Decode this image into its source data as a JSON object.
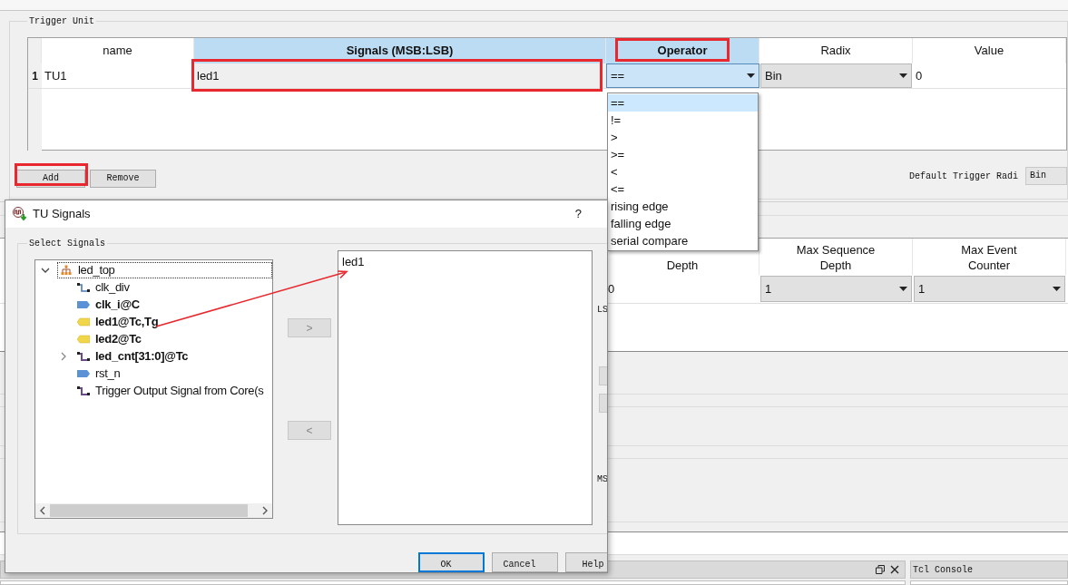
{
  "main": {
    "trigger_unit": {
      "title": "Trigger Unit",
      "columns": [
        {
          "label": "name",
          "selected": false,
          "annotated": false
        },
        {
          "label": "Signals (MSB:LSB)",
          "selected": true,
          "annotated": false
        },
        {
          "label": "Operator",
          "selected": true,
          "annotated": true
        },
        {
          "label": "Radix",
          "selected": false,
          "annotated": false
        },
        {
          "label": "Value",
          "selected": false,
          "annotated": false
        }
      ],
      "rows": [
        {
          "number": "1",
          "name": "TU1",
          "signals": "led1",
          "signals_annotated": true,
          "operator": "==",
          "radix": "Bin",
          "value": "0"
        }
      ],
      "buttons": [
        {
          "label": "Add",
          "annotated": true
        },
        {
          "label": "Remove",
          "annotated": false
        }
      ]
    },
    "default_radix": {
      "label": "Default Trigger Radi",
      "value": "Bin"
    },
    "sequencer": {
      "columns": [
        "Depth",
        "Max Sequence Depth",
        "Max Event Counter"
      ],
      "cells": [
        {
          "kind": "text",
          "value": "0"
        },
        {
          "kind": "select",
          "value": "1"
        },
        {
          "kind": "select",
          "value": "1"
        }
      ]
    },
    "bottom_panel": {
      "title": "Tcl Console"
    }
  },
  "operator_menu": {
    "items": [
      {
        "label": "==",
        "selected": true
      },
      {
        "label": "!=",
        "selected": false
      },
      {
        "label": ">",
        "selected": false
      },
      {
        "label": ">=",
        "selected": false
      },
      {
        "label": "<",
        "selected": false
      },
      {
        "label": "<=",
        "selected": false
      },
      {
        "label": "rising edge",
        "selected": false
      },
      {
        "label": "falling edge",
        "selected": false
      },
      {
        "label": "serial compare",
        "selected": false
      }
    ]
  },
  "dialog": {
    "title": "TU Signals",
    "help": "?",
    "group": "Select Signals",
    "tree": {
      "label": "led_top",
      "kind": "module",
      "emphasized": false,
      "expanded": true,
      "children": [
        {
          "label": "clk_div",
          "kind": "wire",
          "emphasized": false
        },
        {
          "label": "clk_i@C",
          "kind": "input",
          "emphasized": true
        },
        {
          "label": "led1@Tc,Tg",
          "kind": "output",
          "emphasized": true
        },
        {
          "label": "led2@Tc",
          "kind": "output",
          "emphasized": true
        },
        {
          "label": "led_cnt[31:0]@Tc",
          "kind": "bus",
          "emphasized": true,
          "expanded": false
        },
        {
          "label": "rst_n",
          "kind": "input",
          "emphasized": false
        },
        {
          "label": "Trigger Output Signal from Core(s",
          "kind": "bus",
          "emphasized": false
        }
      ]
    },
    "move_right": ">",
    "move_left": "<",
    "selected_signals": [
      "led1"
    ],
    "side_labels": [
      "LS",
      "MS"
    ],
    "buttons": [
      {
        "label": "OK",
        "default": true
      },
      {
        "label": "Cancel",
        "default": false
      },
      {
        "label": "Help",
        "default": false
      }
    ]
  }
}
